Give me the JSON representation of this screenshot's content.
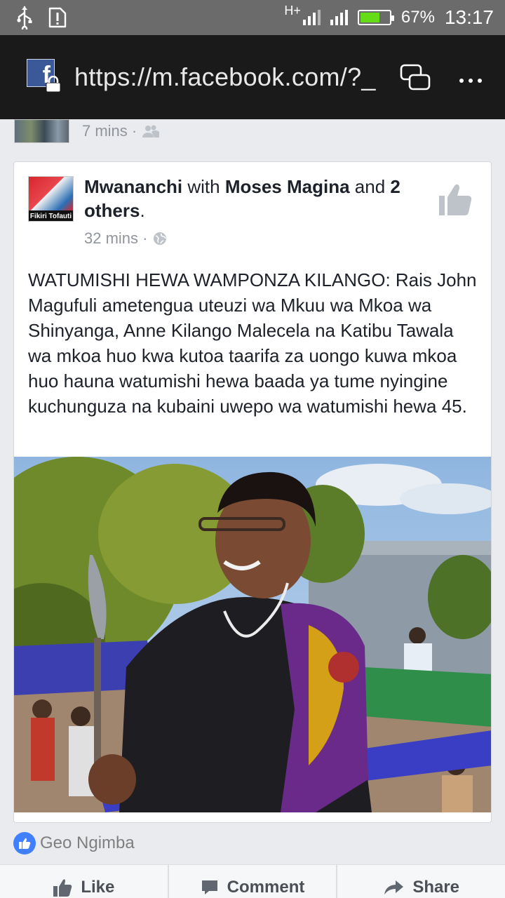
{
  "status_bar": {
    "network": "H+",
    "battery_percent": "67%",
    "battery_level": 0.67,
    "time": "13:17"
  },
  "browser": {
    "url": "https://m.facebook.com/?_",
    "fb_letter": "f"
  },
  "previous_post": {
    "time": "7 mins ·"
  },
  "post": {
    "page_name": "Mwananchi",
    "with_text": " with ",
    "tagged_person": "Moses Magina",
    "and_text": " and ",
    "others_count": "2",
    "others_label": "others",
    "period": ".",
    "time": "32 mins ·",
    "avatar_tagline": "Fikiri Tofauti",
    "body": "WATUMISHI HEWA WAMPONZA KILANGO: Rais John Magufuli ametengua uteuzi wa Mkuu wa Mkoa wa Shinyanga, Anne Kilango Malecela na Katibu Tawala wa mkoa huo kwa kutoa taarifa za uongo kuwa mkoa huo hauna watumishi hewa baada ya tume nyingine kuchunguza na kubaini uwepo wa watumishi hewa 45."
  },
  "reactions": {
    "liker": "Geo Ngimba"
  },
  "actions": {
    "like": "Like",
    "comment": "Comment",
    "share": "Share"
  },
  "colors": {
    "facebook_blue": "#3b5998",
    "like_blue": "#4080ff",
    "meta_gray": "#90949c"
  }
}
